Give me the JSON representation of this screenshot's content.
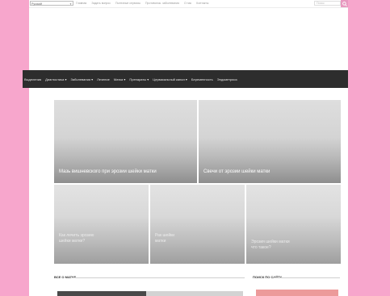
{
  "top_bar": {
    "language": "Русский",
    "links": [
      "Главная",
      "Задать вопрос",
      "Полезные сервисы",
      "Противопок. заболевания",
      "О нас",
      "Контакты"
    ],
    "search_placeholder": "Поиск"
  },
  "nav": {
    "items": [
      "Выделения",
      "Диагностика ▾",
      "Заболевания ▾",
      "Лечение",
      "Матка ▾",
      "Препараты ▾",
      "Цервикальный канал ▾",
      "Беременность",
      "Эндометриоз"
    ]
  },
  "featured": [
    {
      "title": "Мазь вишневского при эрозии шейки матки"
    },
    {
      "title": "Свечи от эрозии шейки матки"
    }
  ],
  "grid": [
    {
      "line1": "Как лечить эрозию",
      "line2": "шейки матки?"
    },
    {
      "line1": "Рак шейки",
      "line2": "матки"
    },
    {
      "line1": "Эрозия шейки матки",
      "line2": "что такое?"
    }
  ],
  "sections": {
    "main_title": "ВСЕ О МАТКЕ",
    "sidebar_title": "ПОИСК ПО САЙТУ"
  },
  "colors": {
    "page_background": "#f7a6cc",
    "nav_background": "#2d2d2d",
    "accent": "#e89ac0"
  }
}
